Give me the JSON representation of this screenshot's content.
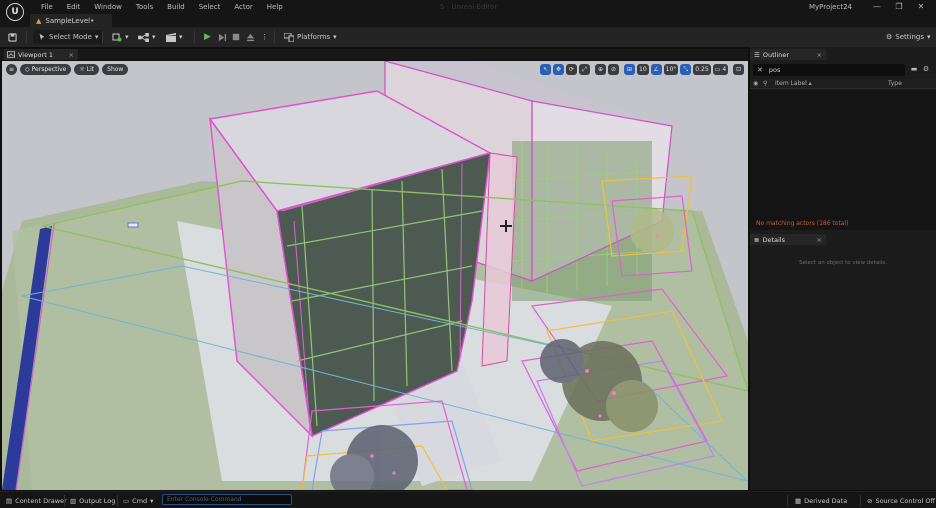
{
  "app": {
    "logo_letter": "U",
    "window_title": "5 - Unreal Editor",
    "project_name": "MyProject24"
  },
  "menu": [
    "File",
    "Edit",
    "Window",
    "Tools",
    "Build",
    "Select",
    "Actor",
    "Help"
  ],
  "window_controls": {
    "minimize": "—",
    "restore": "❐",
    "close": "✕"
  },
  "level_tab": {
    "label": "SampleLevel•"
  },
  "toolbar": {
    "select_mode_label": "Select Mode",
    "platforms_label": "Platforms",
    "settings_label": "Settings"
  },
  "viewport": {
    "tab_label": "Viewport 1",
    "perspective_label": "Perspective",
    "lit_label": "Lit",
    "show_label": "Show",
    "grid_snap_value": "10",
    "rotation_snap_value": "10°",
    "scale_snap_value": "0.25",
    "camera_speed_value": "4"
  },
  "outliner": {
    "tab_label": "Outliner",
    "search_value": "pos",
    "col_label": "Item Label ▴",
    "col_type": "Type",
    "no_match_text": "No matching actors (186 total)"
  },
  "details": {
    "tab_label": "Details",
    "hint": "Select an object to view details."
  },
  "statusbar": {
    "content_drawer": "Content Drawer",
    "output_log": "Output Log",
    "cmd_label": "Cmd",
    "console_placeholder": "Enter Console Command",
    "derived_data": "Derived Data",
    "source_control": "Source Control Off"
  },
  "colors": {
    "accent_blue": "#2a5fb8",
    "play_green": "#5db94d",
    "warning_orange": "#c85a38",
    "level_icon": "#e0a030"
  }
}
